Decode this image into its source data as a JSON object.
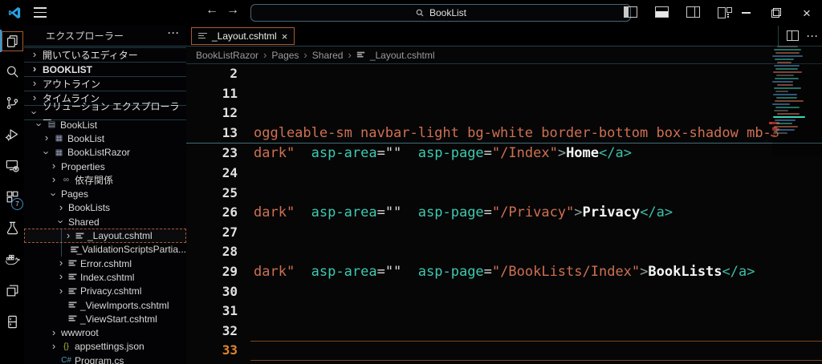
{
  "titlebar": {
    "search_value": "BookList",
    "icons": {
      "back": "←",
      "forward": "→",
      "close": "×",
      "more": "···"
    }
  },
  "activity_bar": {
    "items": [
      {
        "icon": "files",
        "active": true
      },
      {
        "icon": "search"
      },
      {
        "icon": "source-control"
      },
      {
        "icon": "run-debug"
      },
      {
        "icon": "remote-explorer"
      },
      {
        "icon": "extensions",
        "badge": "7"
      },
      {
        "icon": "testing"
      },
      {
        "icon": "docker"
      },
      {
        "icon": "windows"
      },
      {
        "icon": "storage"
      }
    ]
  },
  "sidebar": {
    "title": "エクスプローラー",
    "sections": [
      {
        "label": "開いているエディター",
        "state": "collapsed"
      },
      {
        "label": "BOOKLIST",
        "state": "collapsed",
        "bold": true
      },
      {
        "label": "アウトライン",
        "state": "collapsed"
      },
      {
        "label": "タイムライン",
        "state": "collapsed"
      },
      {
        "label": "ソリューション エクスプローラー",
        "state": "expanded"
      }
    ],
    "tree": [
      {
        "label": "BookList",
        "level": 0,
        "state": "expanded",
        "icon": "solution"
      },
      {
        "label": "BookList",
        "level": 1,
        "state": "collapsed",
        "icon": "project"
      },
      {
        "label": "BookListRazor",
        "level": 1,
        "state": "expanded",
        "icon": "project"
      },
      {
        "label": "Properties",
        "level": 2,
        "state": "collapsed"
      },
      {
        "label": "依存関係",
        "level": 2,
        "state": "collapsed",
        "icon": "dependencies"
      },
      {
        "label": "Pages",
        "level": 2,
        "state": "expanded"
      },
      {
        "label": "BookLists",
        "level": 3,
        "state": "collapsed"
      },
      {
        "label": "Shared",
        "level": 3,
        "state": "expanded"
      },
      {
        "label": "_Layout.cshtml",
        "level": 4,
        "state": "collapsed",
        "icon": "razor",
        "selected": true
      },
      {
        "label": "_ValidationScriptsPartia...",
        "level": 4,
        "state": "none",
        "icon": "razor"
      },
      {
        "label": "Error.cshtml",
        "level": 3,
        "state": "collapsed",
        "icon": "razor"
      },
      {
        "label": "Index.cshtml",
        "level": 3,
        "state": "collapsed",
        "icon": "razor"
      },
      {
        "label": "Privacy.cshtml",
        "level": 3,
        "state": "collapsed",
        "icon": "razor"
      },
      {
        "label": "_ViewImports.cshtml",
        "level": 3,
        "state": "none",
        "icon": "razor"
      },
      {
        "label": "_ViewStart.cshtml",
        "level": 3,
        "state": "none",
        "icon": "razor"
      },
      {
        "label": "wwwroot",
        "level": 2,
        "state": "collapsed"
      },
      {
        "label": "appsettings.json",
        "level": 2,
        "state": "collapsed",
        "icon": "json"
      },
      {
        "label": "Program.cs",
        "level": 2,
        "state": "none",
        "icon": "csharp"
      }
    ]
  },
  "editor": {
    "tab": {
      "label": "_Layout.cshtml",
      "close_glyph": "×"
    },
    "breadcrumb": [
      "BookListRazor",
      "Pages",
      "Shared",
      "_Layout.cshtml"
    ],
    "sticky": [
      {
        "num": "2",
        "tokens": []
      },
      {
        "num": "11",
        "tokens": []
      },
      {
        "num": "12",
        "tokens": []
      },
      {
        "num": "13",
        "tokens": [
          {
            "t": "oggleable-sm navbar-light bg-white border-bottom box-shadow mb-3",
            "c": "str"
          }
        ]
      }
    ],
    "lines": [
      {
        "num": "23",
        "tokens": [
          {
            "t": "dark\"",
            "c": "str"
          },
          {
            "t": "  ",
            "c": "eq"
          },
          {
            "t": "asp-area",
            "c": "attr"
          },
          {
            "t": "=",
            "c": "eq"
          },
          {
            "t": "\"\"",
            "c": "eq"
          },
          {
            "t": "  ",
            "c": "eq"
          },
          {
            "t": "asp-page",
            "c": "attr"
          },
          {
            "t": "=",
            "c": "eq"
          },
          {
            "t": "\"/Index\"",
            "c": "str"
          },
          {
            "t": ">",
            "c": "punct"
          },
          {
            "t": "Home",
            "c": "text"
          },
          {
            "t": "</a>",
            "c": "tag"
          }
        ]
      },
      {
        "num": "24",
        "tokens": []
      },
      {
        "num": "25",
        "tokens": []
      },
      {
        "num": "26",
        "tokens": [
          {
            "t": "dark\"",
            "c": "str"
          },
          {
            "t": "  ",
            "c": "eq"
          },
          {
            "t": "asp-area",
            "c": "attr"
          },
          {
            "t": "=",
            "c": "eq"
          },
          {
            "t": "\"\"",
            "c": "eq"
          },
          {
            "t": "  ",
            "c": "eq"
          },
          {
            "t": "asp-page",
            "c": "attr"
          },
          {
            "t": "=",
            "c": "eq"
          },
          {
            "t": "\"/Privacy\"",
            "c": "str"
          },
          {
            "t": ">",
            "c": "punct"
          },
          {
            "t": "Privacy",
            "c": "text"
          },
          {
            "t": "</a>",
            "c": "tag"
          }
        ]
      },
      {
        "num": "27",
        "tokens": []
      },
      {
        "num": "28",
        "tokens": []
      },
      {
        "num": "29",
        "tokens": [
          {
            "t": "dark\"",
            "c": "str"
          },
          {
            "t": "  ",
            "c": "eq"
          },
          {
            "t": "asp-area",
            "c": "attr"
          },
          {
            "t": "=",
            "c": "eq"
          },
          {
            "t": "\"\"",
            "c": "eq"
          },
          {
            "t": "  ",
            "c": "eq"
          },
          {
            "t": "asp-page",
            "c": "attr"
          },
          {
            "t": "=",
            "c": "eq"
          },
          {
            "t": "\"/BookLists/Index\"",
            "c": "str"
          },
          {
            "t": ">",
            "c": "punct"
          },
          {
            "t": "BookLists",
            "c": "text"
          },
          {
            "t": "</a>",
            "c": "tag"
          }
        ]
      },
      {
        "num": "30",
        "tokens": []
      },
      {
        "num": "31",
        "tokens": []
      },
      {
        "num": "32",
        "tokens": []
      },
      {
        "num": "33",
        "tokens": [],
        "current": true
      }
    ]
  }
}
